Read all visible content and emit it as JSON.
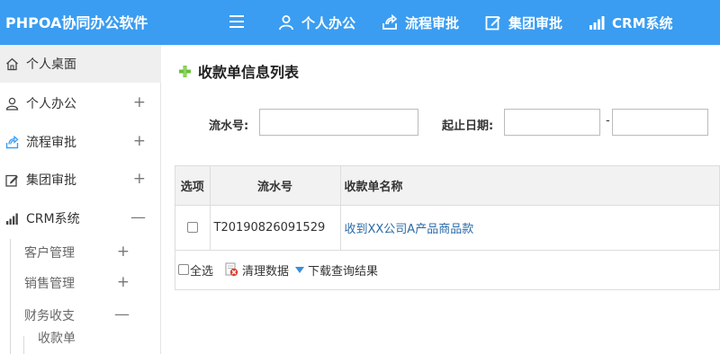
{
  "app": {
    "brand": "PHPOA协同办公软件"
  },
  "topnav": [
    {
      "label": "个人办公",
      "icon": "user-icon"
    },
    {
      "label": "流程审批",
      "icon": "workflow-icon"
    },
    {
      "label": "集团审批",
      "icon": "edit-icon"
    },
    {
      "label": "CRM系统",
      "icon": "bar-chart-icon"
    }
  ],
  "sidebar": {
    "items": [
      {
        "label": "个人桌面",
        "icon": "home-icon",
        "toggle": ""
      },
      {
        "label": "个人办公",
        "icon": "user-icon",
        "toggle": "+"
      },
      {
        "label": "流程审批",
        "icon": "workflow-icon",
        "toggle": "+"
      },
      {
        "label": "集团审批",
        "icon": "edit-icon",
        "toggle": "+"
      },
      {
        "label": "CRM系统",
        "icon": "bar-chart-icon",
        "toggle": "—"
      }
    ],
    "sub_items": [
      {
        "label": "客户管理",
        "toggle": "+"
      },
      {
        "label": "销售管理",
        "toggle": "+"
      },
      {
        "label": "财务收支",
        "toggle": "—"
      }
    ],
    "subsub_item": "收款单"
  },
  "page": {
    "title": "收款单信息列表"
  },
  "filters": {
    "serial_label": "流水号:",
    "serial_value": "",
    "date_label": "起止日期:",
    "date_start": "",
    "date_separator": "-",
    "date_end": ""
  },
  "table": {
    "headers": [
      "选项",
      "流水号",
      "收款单名称"
    ],
    "rows": [
      {
        "serial": "T20190826091529",
        "name": "收到XX公司A产品商品款"
      }
    ]
  },
  "footer": {
    "select_all": "全选",
    "clear_data": "清理数据",
    "download": "下载查询结果"
  },
  "colors": {
    "header": "#3a9df1",
    "link": "#2a6aa8",
    "active_bg": "#efefef"
  }
}
